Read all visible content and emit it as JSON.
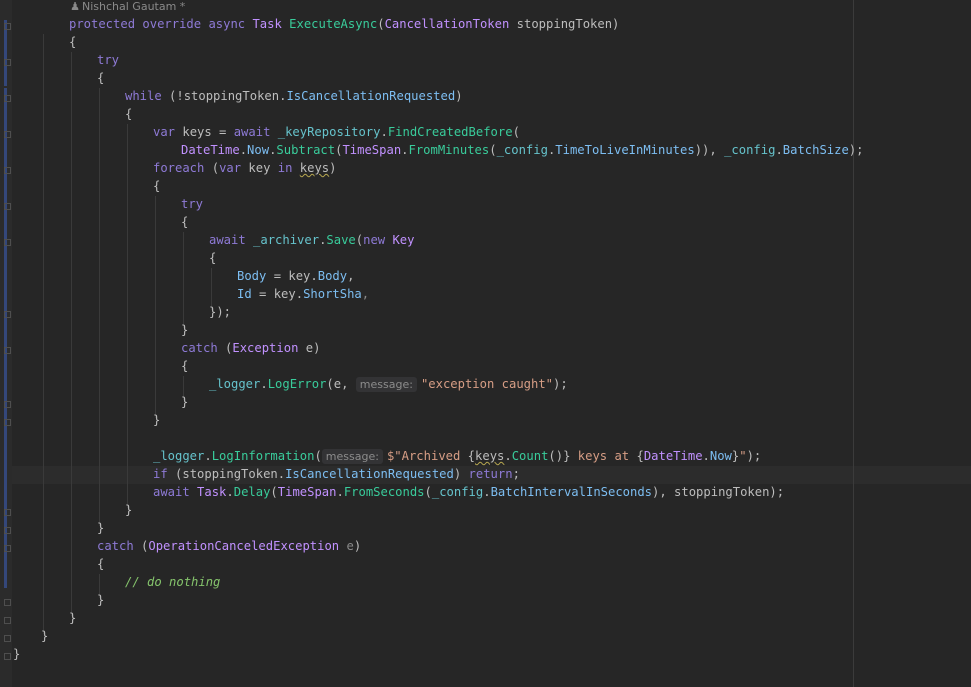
{
  "author": {
    "name": "Nishchal Gautam *"
  },
  "code": {
    "l01": {
      "a": "protected",
      "b": "override",
      "c": "async",
      "d": "Task",
      "e": "ExecuteAsync",
      "f": "(",
      "g": "CancellationToken",
      "h": " stoppingToken)"
    },
    "l02": "{",
    "l03": "try",
    "l04": "{",
    "l05": {
      "a": "while",
      "b": " (!stoppingToken.",
      "c": "IsCancellationRequested",
      "d": ")"
    },
    "l06": "{",
    "l07": {
      "a": "var",
      "b": " keys = ",
      "c": "await",
      "d": " _keyRepository",
      "e": ".",
      "f": "FindCreatedBefore",
      "g": "("
    },
    "l08": {
      "a": "DateTime",
      "b": ".",
      "c": "Now",
      "d": ".",
      "e": "Subtract",
      "f": "(",
      "g": "TimeSpan",
      "h": ".",
      "i": "FromMinutes",
      "j": "(",
      "k": "_config",
      "l": ".",
      "m": "TimeToLiveInMinutes",
      "n": ")), ",
      "o": "_config",
      "p": ".",
      "q": "BatchSize",
      "r": ");"
    },
    "l09": {
      "a": "foreach",
      "b": " (",
      "c": "var",
      "d": " key ",
      "e": "in",
      "f": " ",
      "g": "keys",
      "h": ")"
    },
    "l10": "{",
    "l11": "try",
    "l12": "{",
    "l13": {
      "a": "await",
      "b": " _archiver",
      "c": ".",
      "d": "Save",
      "e": "(",
      "f": "new",
      "g": " ",
      "h": "Key"
    },
    "l14": "{",
    "l15": {
      "a": "Body",
      "b": " = key.",
      "c": "Body",
      "d": ","
    },
    "l16": {
      "a": "Id",
      "b": " = key.",
      "c": "ShortSha",
      "d": ","
    },
    "l17": "});",
    "l18": "}",
    "l19": {
      "a": "catch",
      "b": " (",
      "c": "Exception",
      "d": " e)"
    },
    "l20": "{",
    "l21": {
      "a": "_logger",
      "b": ".",
      "c": "LogError",
      "d": "(e, ",
      "hint": "message:",
      "e": "\"exception caught\"",
      "f": ");"
    },
    "l22": "}",
    "l23": "}",
    "l25": {
      "a": "_logger",
      "b": ".",
      "c": "LogInformation",
      "d": "(",
      "hint": "message:",
      "e": "$\"Archived ",
      "f": "{",
      "g": "keys",
      "h": ".",
      "i": "Count",
      "j": "()",
      "k": "}",
      "l": " keys at ",
      "m": "{",
      "n": "DateTime",
      "o": ".",
      "p": "Now",
      "q": "}",
      "r": "\"",
      "s": ");"
    },
    "l26": {
      "a": "if",
      "b": " (stoppingToken.",
      "c": "IsCancellationRequested",
      "d": ") ",
      "e": "return",
      "f": ";"
    },
    "l27": {
      "a": "await",
      "b": " ",
      "c": "Task",
      "d": ".",
      "e": "Delay",
      "f": "(",
      "g": "TimeSpan",
      "h": ".",
      "i": "FromSeconds",
      "j": "(",
      "k": "_config",
      "l": ".",
      "m": "BatchIntervalInSeconds",
      "n": "), stoppingToken);"
    },
    "l28": "}",
    "l29": "}",
    "l30": {
      "a": "catch",
      "b": " (",
      "c": "OperationCanceledException",
      "d": " ",
      "e": "e",
      "f": ")"
    },
    "l31": "{",
    "l32": "// do nothing",
    "l33": "}",
    "l34": "}",
    "l35": "}",
    "l36": "}"
  },
  "colors": {
    "background": "#262626",
    "keyword": "#8e7ad6",
    "type": "#c191ff",
    "method": "#39cc9b",
    "field": "#66c3cc",
    "string": "#d69d85",
    "comment": "#85c46c"
  }
}
